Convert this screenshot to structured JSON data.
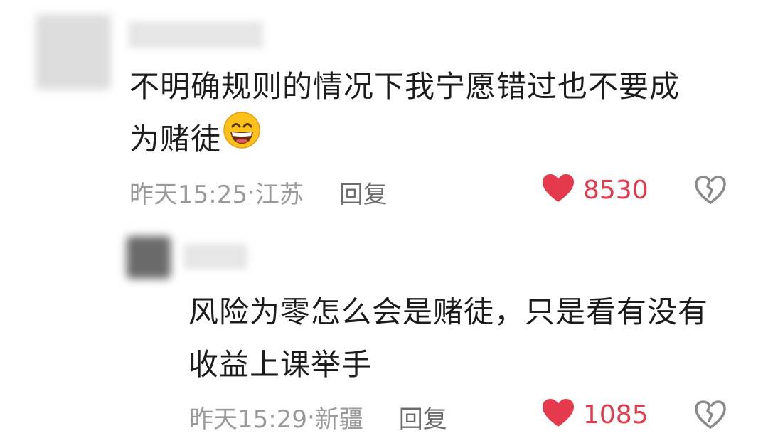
{
  "comment1": {
    "text_line1": "不明确规则的情况下我宁愿错过也不要成",
    "text_line2": "为赌徒",
    "emoji": "grinning-face-emoji",
    "time": "昨天15:25",
    "separator": " · ",
    "location": "江苏",
    "reply_label": "回复",
    "likes": "8530"
  },
  "reply1": {
    "text_line1": "风险为零怎么会是赌徒，只是看有没有",
    "text_line2": "收益上课举手",
    "time": "昨天15:29",
    "separator": " · ",
    "location": "新疆",
    "reply_label": "回复",
    "likes": "1085"
  },
  "colors": {
    "like_red": "#e53a4d",
    "meta_gray": "#9a9a9a",
    "text": "#1c1c1c"
  },
  "icons": [
    "heart-icon",
    "broken-heart-icon"
  ]
}
